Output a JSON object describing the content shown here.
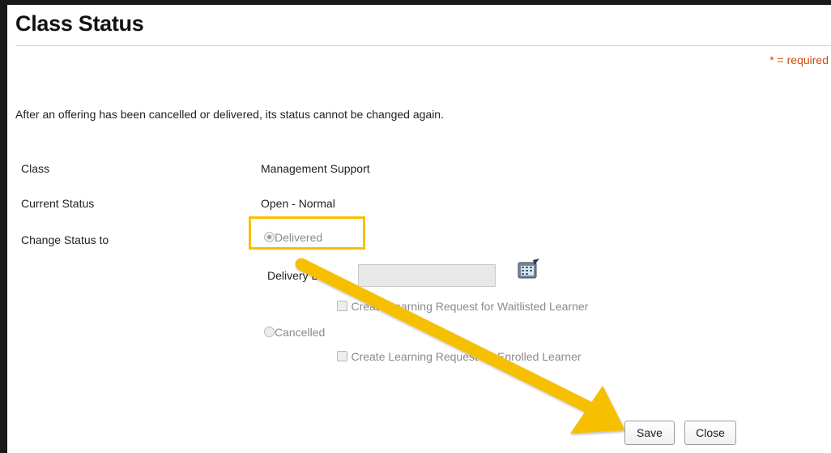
{
  "page": {
    "title": "Class Status",
    "required_note": "* = required",
    "info_text": "After an offering has been cancelled or delivered, its status cannot be changed again."
  },
  "fields": {
    "class_label": "Class",
    "class_value": "Management Support",
    "current_status_label": "Current Status",
    "current_status_value": "Open - Normal",
    "change_status_label": "Change Status to"
  },
  "status_options": {
    "delivered": {
      "label": "Delivered",
      "selected": true
    },
    "delivery_date_label": "Delivery Date",
    "delivery_date_value": "",
    "waitlisted_checkbox": {
      "label": "Create Learning Request for Waitlisted Learner",
      "checked": false
    },
    "cancelled": {
      "label": "Cancelled",
      "selected": false
    },
    "enrolled_checkbox": {
      "label": "Create Learning Request for Enrolled Learner",
      "checked": false
    }
  },
  "buttons": {
    "save_label": "Save",
    "close_label": "Close"
  },
  "annotation": {
    "highlight_color": "#f6c000",
    "arrow_color": "#f6c000"
  },
  "icons": {
    "calendar": "calendar-icon"
  }
}
